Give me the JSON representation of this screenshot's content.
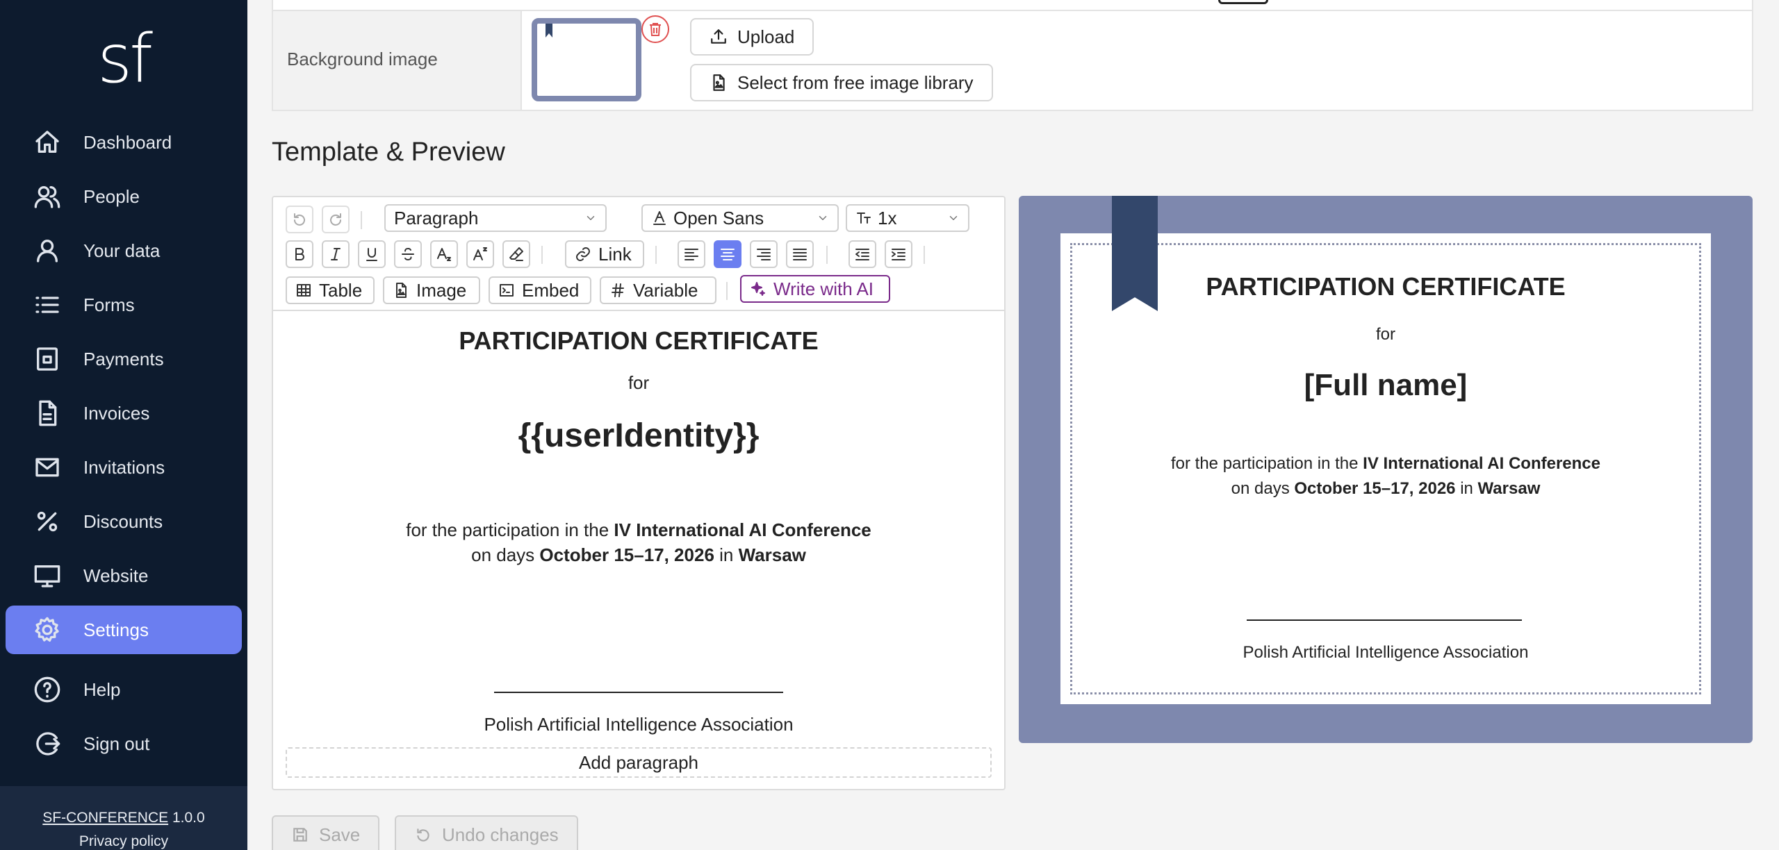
{
  "app": {
    "logo": "sf",
    "version_name": "SF-CONFERENCE",
    "version_number": "1.0.0",
    "privacy": "Privacy policy"
  },
  "nav": [
    {
      "label": "Dashboard",
      "icon": "home-icon"
    },
    {
      "label": "People",
      "icon": "people-icon"
    },
    {
      "label": "Your data",
      "icon": "user-icon"
    },
    {
      "label": "Forms",
      "icon": "list-icon"
    },
    {
      "label": "Payments",
      "icon": "wallet-icon"
    },
    {
      "label": "Invoices",
      "icon": "document-icon"
    },
    {
      "label": "Invitations",
      "icon": "envelope-icon"
    },
    {
      "label": "Discounts",
      "icon": "percent-icon"
    },
    {
      "label": "Website",
      "icon": "monitor-icon"
    },
    {
      "label": "Settings",
      "icon": "gear-icon",
      "active": true
    },
    {
      "label": "Help",
      "icon": "question-icon"
    },
    {
      "label": "Sign out",
      "icon": "sign-out-icon"
    }
  ],
  "background": {
    "label": "Background image",
    "upload": "Upload",
    "library": "Select from free image library"
  },
  "section_title": "Template & Preview",
  "toolbar": {
    "block_type": "Paragraph",
    "font": "Open Sans",
    "size": "1x",
    "link": "Link",
    "table": "Table",
    "image": "Image",
    "embed": "Embed",
    "variable": "Variable",
    "ai": "Write with AI"
  },
  "editor": {
    "title": "PARTICIPATION CERTIFICATE",
    "for": "for",
    "identity": "{{userIdentity}}",
    "line1_pre": "for the participation in the ",
    "line1_bold": "IV International AI Conference",
    "line2_pre": "on days ",
    "line2_date": "October 15–17, 2026",
    "line2_in": " in ",
    "line2_city": "Warsaw",
    "association": "Polish Artificial Intelligence Association",
    "add_paragraph": "Add paragraph"
  },
  "preview": {
    "title": "PARTICIPATION CERTIFICATE",
    "for": "for",
    "name": "[Full name]",
    "line1_pre": "for the participation in the ",
    "line1_bold": "IV International AI Conference",
    "line2_pre": "on days ",
    "line2_date": "October 15–17, 2026",
    "line2_in": " in ",
    "line2_city": "Warsaw",
    "association": "Polish Artificial Intelligence Association"
  },
  "footer": {
    "save": "Save",
    "undo": "Undo changes"
  },
  "colors": {
    "sidebar": "#0d1b2e",
    "accent": "#6b7ef0",
    "preview_frame": "#7e88ae",
    "ribbon": "#33476b",
    "ai": "#7a2a8a",
    "danger": "#e05050"
  }
}
